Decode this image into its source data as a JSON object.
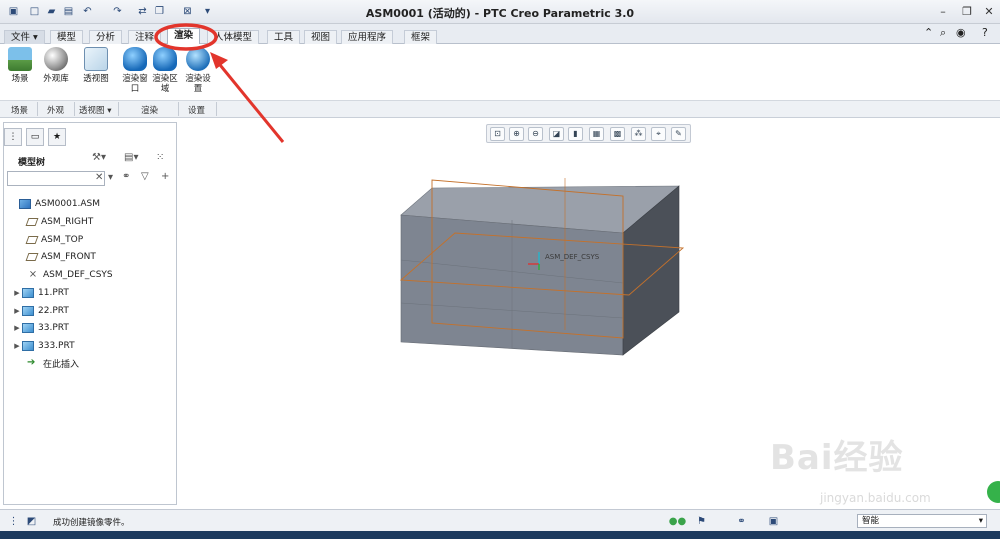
{
  "window": {
    "title": "ASM0001 (活动的) - PTC Creo Parametric 3.0"
  },
  "tabs": [
    {
      "label": "文件 ▾"
    },
    {
      "label": "模型"
    },
    {
      "label": "分析"
    },
    {
      "label": "注释"
    },
    {
      "label": "渲染"
    },
    {
      "label": "人体模型"
    },
    {
      "label": "工具"
    },
    {
      "label": "视图"
    },
    {
      "label": "应用程序"
    },
    {
      "label": "框架"
    }
  ],
  "ribbon": {
    "buttons": [
      {
        "label": "场景"
      },
      {
        "label": "外观库"
      },
      {
        "label": "透视图"
      },
      {
        "label": "渲染窗口"
      },
      {
        "label": "渲染区域"
      },
      {
        "label": "渲染设置"
      }
    ],
    "groups": [
      {
        "label": "场景"
      },
      {
        "label": "外观"
      },
      {
        "label": "透视图 ▾"
      },
      {
        "label": "渲染"
      },
      {
        "label": "设置"
      }
    ]
  },
  "model_tree": {
    "title": "模型树",
    "items": [
      {
        "label": "ASM0001.ASM",
        "icon": "assembly-icon"
      },
      {
        "label": "ASM_RIGHT",
        "icon": "datum-plane-icon"
      },
      {
        "label": "ASM_TOP",
        "icon": "datum-plane-icon"
      },
      {
        "label": "ASM_FRONT",
        "icon": "datum-plane-icon"
      },
      {
        "label": "ASM_DEF_CSYS",
        "icon": "coordinate-system-icon"
      },
      {
        "label": "11.PRT",
        "icon": "part-icon"
      },
      {
        "label": "22.PRT",
        "icon": "part-icon"
      },
      {
        "label": "33.PRT",
        "icon": "part-icon"
      },
      {
        "label": "333.PRT",
        "icon": "part-icon"
      },
      {
        "label": "在此插入",
        "icon": "insert-here-icon"
      }
    ]
  },
  "graphics": {
    "csys_label": "ASM_DEF_CSYS"
  },
  "status": {
    "message": "成功创建镜像零件。",
    "filter": "智能"
  },
  "watermark": {
    "text": "Bai经验",
    "sub": "jingyan.baidu.com"
  },
  "colors": {
    "annotation_red": "#e2352c",
    "box_face_front": "#7e8591",
    "box_face_top": "#9aa0aa",
    "box_face_side": "#4b5058",
    "datum_orange": "#c4712b"
  }
}
